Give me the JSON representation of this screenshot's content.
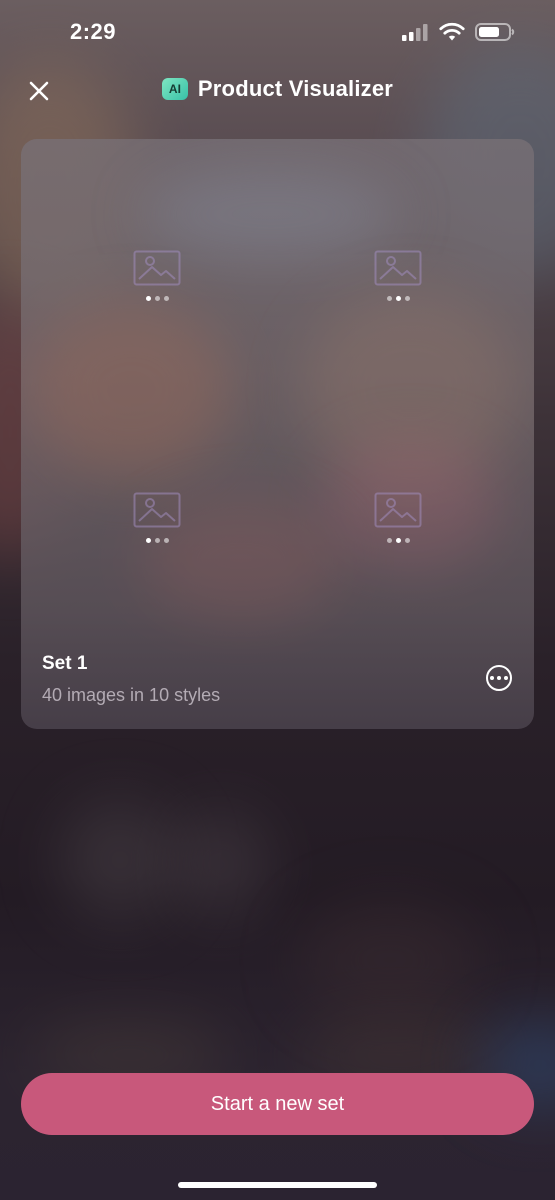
{
  "status_bar": {
    "time": "2:29",
    "icons": [
      "cellular-signal-icon",
      "wifi-icon",
      "battery-icon"
    ]
  },
  "header": {
    "close_icon": "close-icon",
    "badge": "AI",
    "title": "Product Visualizer"
  },
  "card": {
    "placeholders": [
      {
        "icon": "image-placeholder-icon"
      },
      {
        "icon": "image-placeholder-icon"
      },
      {
        "icon": "image-placeholder-icon"
      },
      {
        "icon": "image-placeholder-icon"
      }
    ],
    "set_name": "Set 1",
    "subtitle": "40 images in 10 styles",
    "more_icon": "more-options-icon"
  },
  "cta": {
    "label": "Start a new set"
  },
  "colors": {
    "accent": "#c8587b",
    "ai_badge": "#4fd1b3",
    "subtitle_text": "#b3abb4"
  }
}
